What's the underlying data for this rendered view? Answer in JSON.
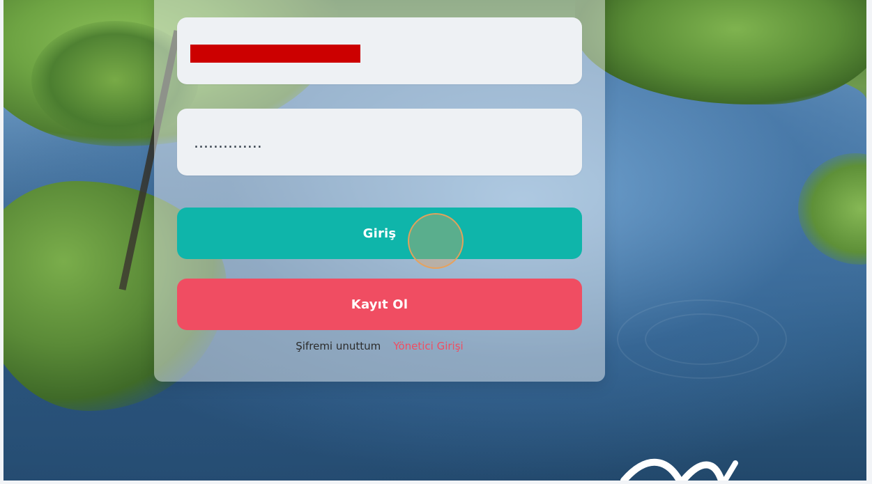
{
  "form": {
    "email_placeholder": "",
    "email_value": "",
    "password_value": "..............",
    "login_label": "Giriş",
    "register_label": "Kayıt Ol"
  },
  "links": {
    "forgot_password": "Şifremi unuttum",
    "admin_login": "Yönetici Girişi"
  },
  "colors": {
    "login_button": "#0fb5aa",
    "register_button": "#f04d62",
    "admin_link": "#f04d62",
    "redaction": "#cc0000",
    "cursor_ring": "#e8a05a"
  }
}
